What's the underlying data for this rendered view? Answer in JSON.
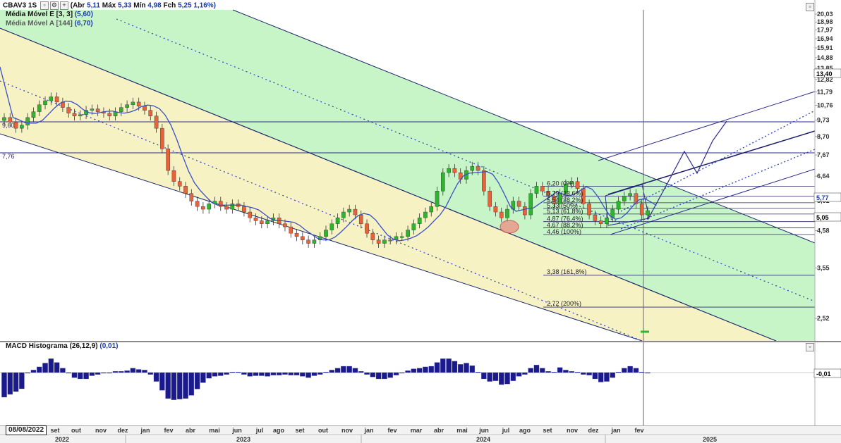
{
  "header": {
    "ticker": "CBAV3 1S",
    "open_label": "(Abr",
    "open": "5,11",
    "high_label": "Máx",
    "high": "5,33",
    "low_label": "Mín",
    "low": "4,98",
    "close_label": "Fch",
    "close": "5,25",
    "change": "1,16%)",
    "ma_e_label": "Média Móvel E [3, 3]",
    "ma_e_value": "(5,60)",
    "ma_a_label": "Média Móvel A [144]",
    "ma_a_value": "(6,70)"
  },
  "macd": {
    "label": "MACD Histograma (26,12,9)",
    "value": "(0,01)",
    "current_tag": "-0,01"
  },
  "date_tag": "08/08/2022",
  "colors": {
    "up": "#2db52d",
    "down": "#e8623a",
    "ma": "#3a4fc4",
    "channel_green": "#c8f5c8",
    "channel_yellow": "#f7f2c4",
    "macd_bar": "#1a1a8c"
  },
  "chart_data": {
    "type": "candlestick",
    "y_ticks": [
      "20,03",
      "18,98",
      "17,97",
      "16,94",
      "15,91",
      "14,88",
      "13,85",
      "12,82",
      "11,79",
      "10,76",
      "9,73",
      "8,70",
      "7,67",
      "6,64",
      "5,61",
      "4,58",
      "3,55",
      "2,52"
    ],
    "current_price_tag": "13,40",
    "price_tag_577": "5,77",
    "price_tag_505": "5,05",
    "left_level_labels": [
      "9,60",
      "7,76"
    ],
    "fib_levels": [
      {
        "label": "6,20 (0%)",
        "value": 6.2
      },
      {
        "label": "5,79 (23,6%)",
        "value": 5.79
      },
      {
        "label": "5,54 (38,2%)",
        "value": 5.54
      },
      {
        "label": "5,33 (50%)",
        "value": 5.33
      },
      {
        "label": "5,13 (61,8%)",
        "value": 5.13
      },
      {
        "label": "4,87 (76,4%)",
        "value": 4.87
      },
      {
        "label": "4,67 (88,2%)",
        "value": 4.67
      },
      {
        "label": "4,46 (100%)",
        "value": 4.46
      },
      {
        "label": "3,38 (161,8%)",
        "value": 3.38
      },
      {
        "label": "2,72 (200%)",
        "value": 2.72
      }
    ],
    "x_months": [
      "set",
      "out",
      "nov",
      "dez",
      "jan",
      "fev",
      "abr",
      "mai",
      "jun",
      "jul",
      "ago",
      "set",
      "out",
      "nov",
      "jan",
      "fev",
      "mar",
      "abr",
      "mai",
      "jun",
      "jul",
      "ago",
      "set",
      "nov",
      "dez",
      "jan",
      "fev"
    ],
    "x_years": [
      "2022",
      "2023",
      "2024",
      "2025"
    ],
    "price_series": [
      9.9,
      9.6,
      9.2,
      9.4,
      9.9,
      10.3,
      10.8,
      11.1,
      11.4,
      11.0,
      10.6,
      10.2,
      10.0,
      10.1,
      10.4,
      10.5,
      10.3,
      10.2,
      10.0,
      10.3,
      10.6,
      10.8,
      11.0,
      10.7,
      10.4,
      10.0,
      9.2,
      8.0,
      6.9,
      6.4,
      6.2,
      5.9,
      5.6,
      5.4,
      5.3,
      5.5,
      5.6,
      5.4,
      5.3,
      5.5,
      5.4,
      5.2,
      5.0,
      4.9,
      4.8,
      4.9,
      5.0,
      4.8,
      4.7,
      4.5,
      4.4,
      4.3,
      4.2,
      4.3,
      4.4,
      4.6,
      4.8,
      5.0,
      5.2,
      5.3,
      5.1,
      4.8,
      4.5,
      4.3,
      4.2,
      4.3,
      4.3,
      4.4,
      4.4,
      4.6,
      4.8,
      5.0,
      5.2,
      5.4,
      6.0,
      6.8,
      7.0,
      6.8,
      6.5,
      6.9,
      7.1,
      6.9,
      6.0,
      5.4,
      5.2,
      5.0,
      5.3,
      5.6,
      5.4,
      5.1,
      5.9,
      6.2,
      6.0,
      5.8,
      5.5,
      5.9,
      6.3,
      6.4,
      6.1,
      5.5,
      5.1,
      4.9,
      4.8,
      5.0,
      5.3,
      5.6,
      5.8,
      5.9,
      5.5,
      5.1,
      5.25
    ]
  }
}
